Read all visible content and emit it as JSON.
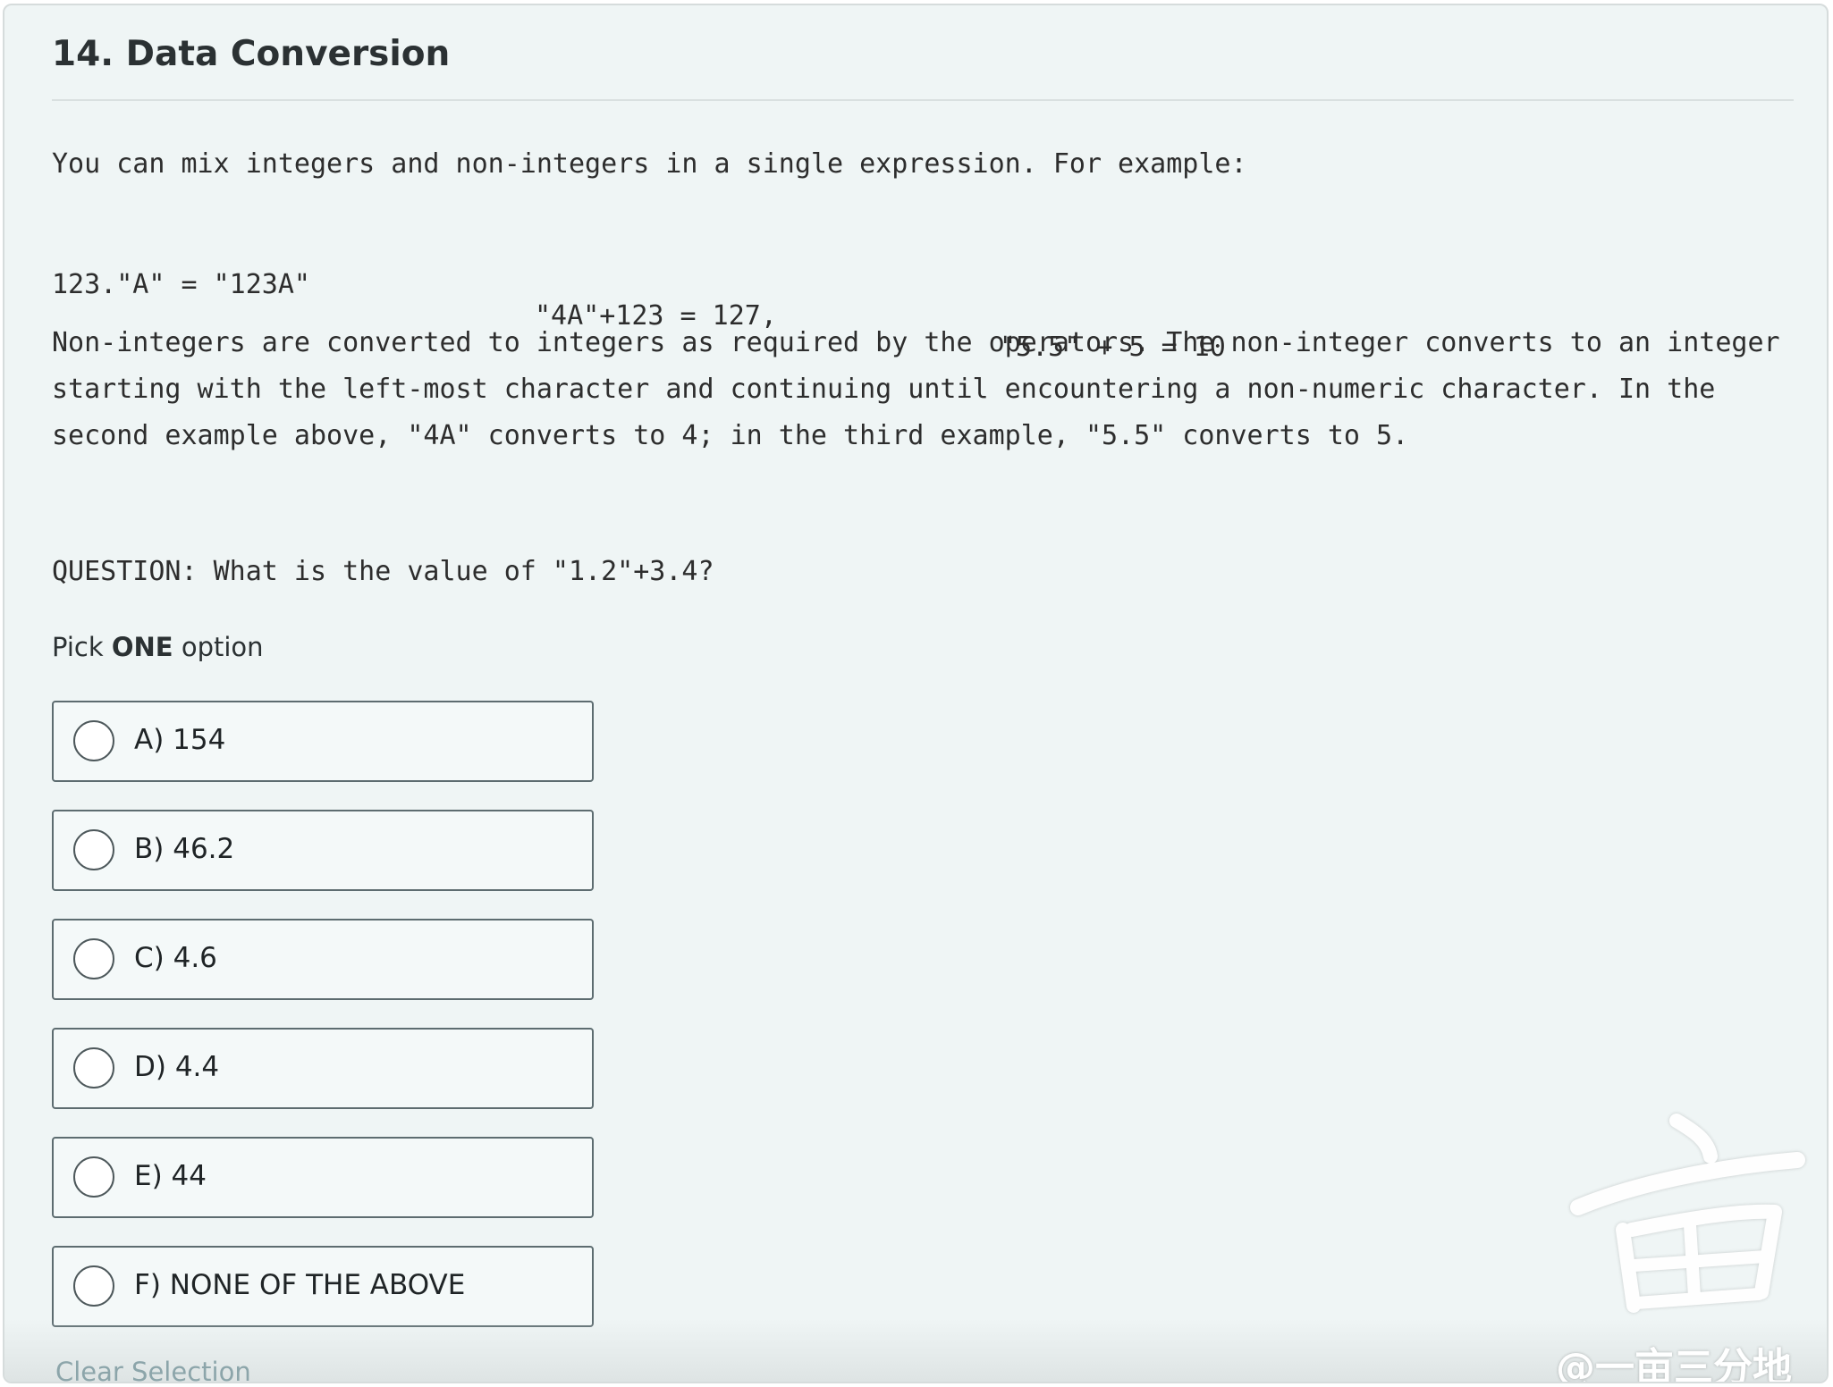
{
  "question": {
    "title": "14. Data Conversion",
    "intro": "You can mix integers and non-integers in a single expression. For example:",
    "examples": [
      "123.\"A\" = \"123A\"",
      "\"4A\"+123 = 127,",
      "\"5.5\" + 5 = 10"
    ],
    "explanation": "Non-integers are converted to integers as required by the operators. The non-integer converts to an integer starting with the left-most character and continuing until encountering a non-numeric character. In the second example above, \"4A\" converts to 4; in the third example, \"5.5\" converts to 5.",
    "prompt": "QUESTION: What is the value of \"1.2\"+3.4?"
  },
  "pick": {
    "prefix": "Pick ",
    "emphasis": "ONE",
    "suffix": " option"
  },
  "options": [
    {
      "label": "A) 154",
      "selected": false
    },
    {
      "label": "B) 46.2",
      "selected": false
    },
    {
      "label": "C) 4.6",
      "selected": false
    },
    {
      "label": "D) 4.4",
      "selected": false
    },
    {
      "label": "E) 44",
      "selected": false
    },
    {
      "label": "F) NONE OF THE ABOVE",
      "selected": false
    }
  ],
  "clear_selection": "Clear Selection",
  "watermark": {
    "glyph": "亩",
    "text": "@一亩三分地"
  },
  "colors": {
    "card_background": "#eff5f5",
    "option_border": "#5d6c70",
    "clear_link": "#8ca5aa"
  }
}
